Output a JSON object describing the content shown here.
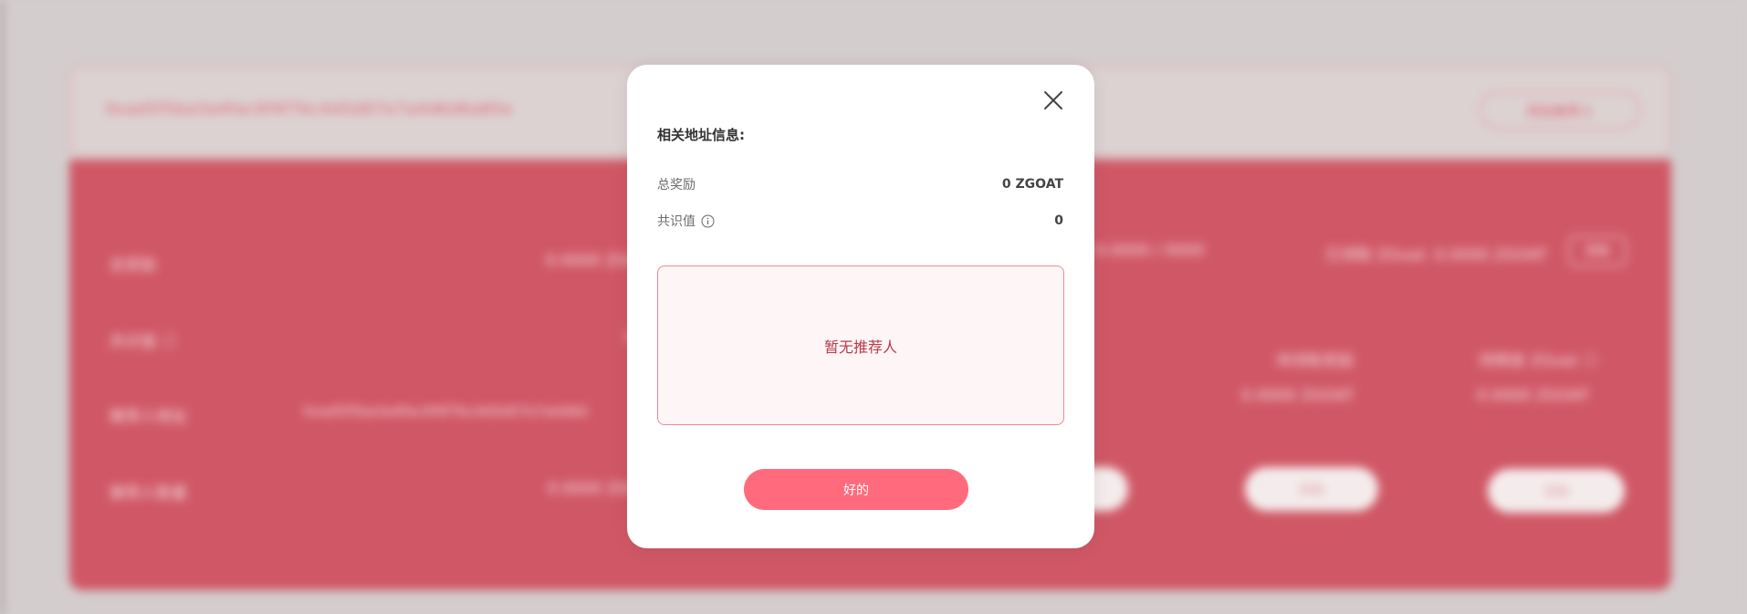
{
  "background": {
    "address": "0xad5f5ba3a4fac0f4f7bc4d5d07e7a4d6d6a85e",
    "top_button_label": "添加推荐人",
    "rows": [
      {
        "label": "总奖励",
        "value": "0.0000 ZGOAT"
      },
      {
        "label": "共识值 ⓘ",
        "value": "0"
      },
      {
        "label": "推荐人地址",
        "value": "0xad5f5ba3a4fac0f4f7bc4d5d07e7a4d6d"
      },
      {
        "label": "推荐人数量",
        "value": "0.0000 ZGOAT"
      }
    ],
    "right_summary": "已领取 ZGoat: 0.0000 ZGOAT",
    "small_button": "领取",
    "col_header_1": "待领取奖励",
    "col_header_2": "待释放 ZGoat ⓘ",
    "col_value_1": "0.0000 ZGOAT",
    "col_value_2": "0.0000 ZGOAT",
    "pill_1": "领取",
    "pill_2": "领取",
    "pill_3": "领取",
    "mid_value": "0.0000 / 0000"
  },
  "modal": {
    "title": "相关地址信息:",
    "total_reward_label": "总奖励",
    "total_reward_value": "0 ZGOAT",
    "consensus_label": "共识值",
    "consensus_value": "0",
    "empty_referrer_text": "暂无推荐人",
    "ok_button_label": "好的"
  },
  "colors": {
    "accent": "#ff6b7d",
    "panel_bg": "#d05866",
    "referrer_text": "#b83a4b"
  }
}
